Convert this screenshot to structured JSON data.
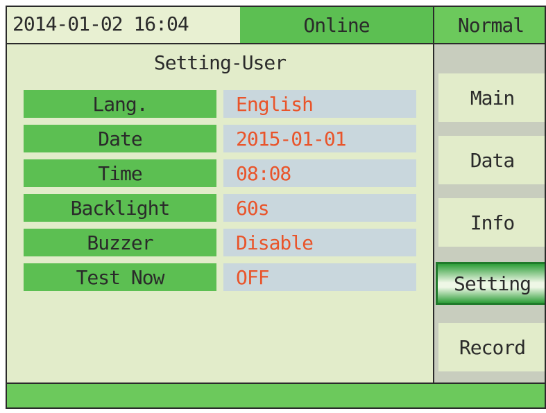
{
  "header": {
    "datetime": "2014-01-02 16:04",
    "status": "Online",
    "mode": "Normal"
  },
  "main": {
    "title": "Setting-User",
    "rows": [
      {
        "label": "Lang.",
        "value": "English"
      },
      {
        "label": "Date",
        "value": "2015-01-01"
      },
      {
        "label": "Time",
        "value": "08:08"
      },
      {
        "label": "Backlight",
        "value": "60s"
      },
      {
        "label": "Buzzer",
        "value": "Disable"
      },
      {
        "label": "Test Now",
        "value": "OFF"
      }
    ]
  },
  "sidebar": {
    "items": [
      {
        "label": "Main"
      },
      {
        "label": "Data"
      },
      {
        "label": "Info"
      },
      {
        "label": "Setting",
        "active": true
      },
      {
        "label": "Record"
      }
    ]
  },
  "colors": {
    "background": "#e2ecca",
    "label_bg": "#5cbf52",
    "value_bg": "#c9d7dd",
    "value_text": "#e9542a",
    "active_border": "#1f7a2a"
  }
}
